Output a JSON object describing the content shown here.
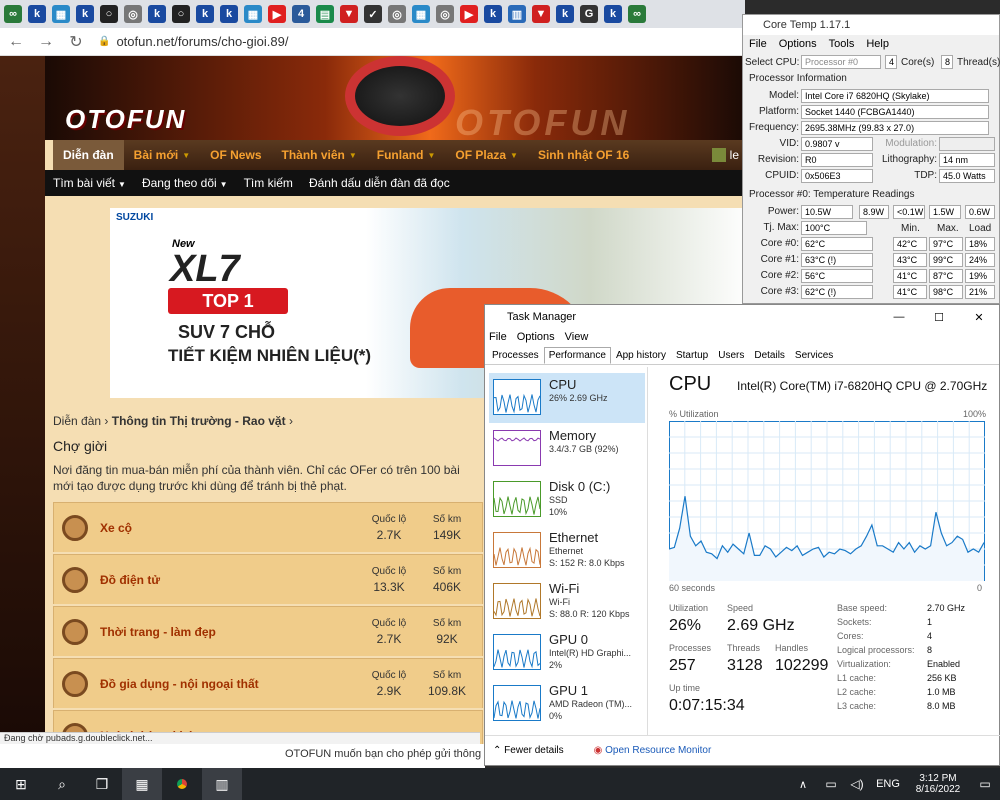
{
  "browser": {
    "url": "otofun.net/forums/cho-gioi.89/",
    "tab_icons": [
      {
        "letter": "∞",
        "color": "#2a7a3a"
      },
      {
        "letter": "k",
        "color": "#1a4aa0"
      },
      {
        "letter": "▦",
        "color": "#2a8ac8"
      },
      {
        "letter": "k",
        "color": "#1a4aa0"
      },
      {
        "letter": "○",
        "color": "#222"
      },
      {
        "letter": "◎",
        "color": "#777"
      },
      {
        "letter": "k",
        "color": "#1a4aa0"
      },
      {
        "letter": "○",
        "color": "#222"
      },
      {
        "letter": "k",
        "color": "#1a4aa0"
      },
      {
        "letter": "k",
        "color": "#1a4aa0"
      },
      {
        "letter": "▦",
        "color": "#2a8ac8"
      },
      {
        "letter": "▶",
        "color": "#e02020"
      },
      {
        "letter": "4",
        "color": "#2a5a9a"
      },
      {
        "letter": "▤",
        "color": "#1a8a4a"
      },
      {
        "letter": "▼",
        "color": "#d02020"
      },
      {
        "letter": "✓",
        "color": "#333"
      },
      {
        "letter": "◎",
        "color": "#777"
      },
      {
        "letter": "▦",
        "color": "#2a8ac8"
      },
      {
        "letter": "◎",
        "color": "#777"
      },
      {
        "letter": "▶",
        "color": "#e02020"
      },
      {
        "letter": "k",
        "color": "#1a4aa0"
      },
      {
        "letter": "▥",
        "color": "#2a6ab8"
      },
      {
        "letter": "▼",
        "color": "#d02020"
      },
      {
        "letter": "k",
        "color": "#1a4aa0"
      },
      {
        "letter": "G",
        "color": "#333"
      },
      {
        "letter": "k",
        "color": "#1a4aa0"
      },
      {
        "letter": "∞",
        "color": "#2a7a3a"
      }
    ],
    "status": "Đang chờ pubads.g.doubleclick.net...",
    "notification": "OTOFUN muốn bạn cho phép gửi thông"
  },
  "site": {
    "logo": "OTOFUN",
    "logo_bg": "OTOFUN",
    "nav": [
      "Diễn đàn",
      "Bài mới",
      "OF News",
      "Thành viên",
      "Funland",
      "OF Plaza",
      "Sinh nhật OF 16"
    ],
    "nav_dropdown": [
      "false",
      "true",
      "false",
      "true",
      "true",
      "true",
      "false"
    ],
    "nav_tail": "le",
    "subnav": [
      "Tìm bài viết",
      "Đang theo dõi",
      "Tìm kiếm",
      "Đánh dấu diễn đàn đã đọc"
    ],
    "ad": {
      "brand": "SUZUKI",
      "new": "New",
      "model": "XL7",
      "badge": "TOP 1",
      "line1": "SUV 7 CHỖ",
      "line2": "TIẾT KIỆM NHIÊN LIỆU(*)"
    },
    "breadcrumb_root": "Diễn đàn",
    "breadcrumb_current": "Thông tin Thị trường - Rao vặt",
    "page_title": "Chợ giời",
    "page_desc": "Nơi đăng tin mua-bán miễn phí của thành viên. Chỉ các OFer có trên 100 bài mới tạo được dụng trước khi dùng để tránh bị thẻ phạt.",
    "stat_label_1": "Quốc lộ",
    "stat_label_2": "Số km",
    "forums": [
      {
        "name": "Xe cộ",
        "s1": "2.7K",
        "s2": "149K"
      },
      {
        "name": "Đồ điện tử",
        "s1": "13.3K",
        "s2": "406K"
      },
      {
        "name": "Thời trang - làm đẹp",
        "s1": "2.7K",
        "s2": "92K"
      },
      {
        "name": "Đồ gia dụng - nội ngoại thất",
        "s1": "2.9K",
        "s2": "109.8K"
      },
      {
        "name": "Ngành hàng khác",
        "s1": "",
        "s2": ""
      }
    ]
  },
  "coretemp": {
    "title": "Core Temp 1.17.1",
    "menu": [
      "File",
      "Options",
      "Tools",
      "Help"
    ],
    "select_cpu_label": "Select CPU:",
    "processor": "Processor #0",
    "cores": "4",
    "cores_label": "Core(s)",
    "threads": "8",
    "threads_label": "Thread(s)",
    "info_title": "Processor Information",
    "model_label": "Model:",
    "model": "Intel Core i7 6820HQ (Skylake)",
    "platform_label": "Platform:",
    "platform": "Socket 1440 (FCBGA1440)",
    "frequency_label": "Frequency:",
    "frequency": "2695.38MHz (99.83 x 27.0)",
    "vid_label": "VID:",
    "vid": "0.9807 v",
    "modulation_label": "Modulation:",
    "revision_label": "Revision:",
    "revision": "R0",
    "litho_label": "Lithography:",
    "litho": "14 nm",
    "cpuid_label": "CPUID:",
    "cpuid": "0x506E3",
    "tdp_label": "TDP:",
    "tdp": "45.0 Watts",
    "temp_title": "Processor #0: Temperature Readings",
    "power_label": "Power:",
    "power": [
      "10.5W",
      "8.9W",
      "<0.1W",
      "1.5W",
      "0.6W"
    ],
    "tjmax_label": "Tj. Max:",
    "tjmax": "100°C",
    "col_min": "Min.",
    "col_max": "Max.",
    "col_load": "Load",
    "cores_rows": [
      {
        "label": "Core #0:",
        "temp": "62°C",
        "min": "42°C",
        "max": "97°C",
        "load": "18%"
      },
      {
        "label": "Core #1:",
        "temp": "63°C (!)",
        "min": "43°C",
        "max": "99°C",
        "load": "24%"
      },
      {
        "label": "Core #2:",
        "temp": "56°C",
        "min": "41°C",
        "max": "87°C",
        "load": "19%"
      },
      {
        "label": "Core #3:",
        "temp": "62°C (!)",
        "min": "41°C",
        "max": "98°C",
        "load": "21%"
      }
    ]
  },
  "taskmgr": {
    "title": "Task Manager",
    "menu": [
      "File",
      "Options",
      "View"
    ],
    "tabs": [
      "Processes",
      "Performance",
      "App history",
      "Startup",
      "Users",
      "Details",
      "Services"
    ],
    "resources": [
      {
        "name": "CPU",
        "sub1": "26%  2.69 GHz",
        "sub2": "",
        "sub3": "",
        "color": "#1a7ac8"
      },
      {
        "name": "Memory",
        "sub1": "3.4/3.7 GB (92%)",
        "sub2": "",
        "sub3": "",
        "color": "#8a3ab0"
      },
      {
        "name": "Disk 0 (C:)",
        "sub1": "SSD",
        "sub2": "10%",
        "sub3": "",
        "color": "#4a9a2a"
      },
      {
        "name": "Ethernet",
        "sub1": "Ethernet",
        "sub2": "S: 152  R: 8.0 Kbps",
        "sub3": "",
        "color": "#c8783a"
      },
      {
        "name": "Wi-Fi",
        "sub1": "Wi-Fi",
        "sub2": "S: 88.0  R: 120 Kbps",
        "sub3": "",
        "color": "#b0782a"
      },
      {
        "name": "GPU 0",
        "sub1": "Intel(R) HD Graphi...",
        "sub2": "2%",
        "sub3": "",
        "color": "#1a7ac8"
      },
      {
        "name": "GPU 1",
        "sub1": "AMD Radeon (TM)...",
        "sub2": "0%",
        "sub3": "",
        "color": "#1a7ac8"
      }
    ],
    "cpu_title": "CPU",
    "cpu_model": "Intel(R) Core(TM) i7-6820HQ CPU @ 2.70GHz",
    "util_label": "% Utilization",
    "util_max": "100%",
    "graph_time": "60 seconds",
    "graph_zero": "0",
    "utilization_label": "Utilization",
    "utilization": "26%",
    "speed_label": "Speed",
    "speed": "2.69 GHz",
    "processes_label": "Processes",
    "processes": "257",
    "threads_label": "Threads",
    "threads": "3128",
    "handles_label": "Handles",
    "handles": "102299",
    "uptime_label": "Up time",
    "uptime": "0:07:15:34",
    "specs": [
      {
        "k": "Base speed:",
        "v": "2.70 GHz"
      },
      {
        "k": "Sockets:",
        "v": "1"
      },
      {
        "k": "Cores:",
        "v": "4"
      },
      {
        "k": "Logical processors:",
        "v": "8"
      },
      {
        "k": "Virtualization:",
        "v": "Enabled"
      },
      {
        "k": "L1 cache:",
        "v": "256 KB"
      },
      {
        "k": "L2 cache:",
        "v": "1.0 MB"
      },
      {
        "k": "L3 cache:",
        "v": "8.0 MB"
      }
    ],
    "fewer_details": "Fewer details",
    "open_monitor": "Open Resource Monitor",
    "cpu_history": [
      20,
      21,
      33,
      53,
      28,
      22,
      25,
      18,
      17,
      14,
      22,
      18,
      23,
      20,
      17,
      30,
      16,
      16,
      22,
      20,
      15,
      18,
      21,
      19,
      22,
      16,
      18,
      20,
      21,
      15,
      18,
      17,
      20,
      19,
      17,
      20,
      22,
      28,
      35,
      22,
      22,
      20,
      18,
      24,
      20,
      24,
      18,
      22,
      20,
      22,
      43,
      30,
      22,
      24,
      28,
      26,
      18,
      20,
      18,
      24
    ]
  },
  "taskbar": {
    "lang": "ENG",
    "time": "3:12 PM",
    "date": "8/16/2022"
  }
}
